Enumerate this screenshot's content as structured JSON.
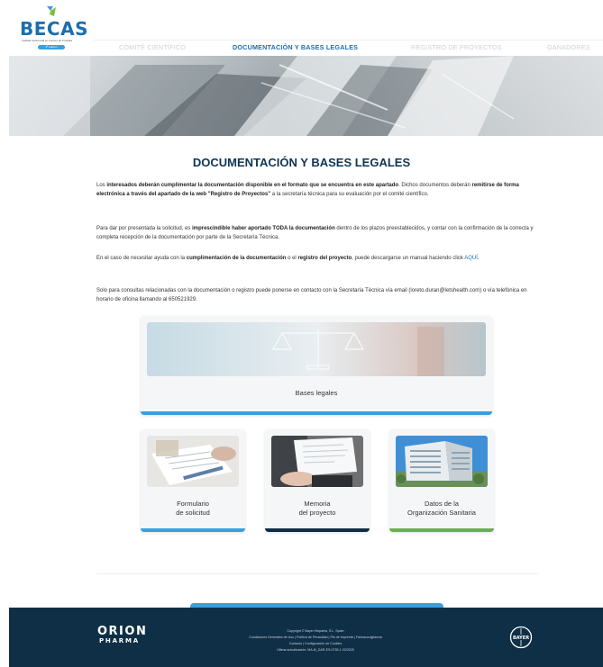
{
  "header": {
    "logo_text": "BECAS",
    "logo_subtitle": "Calidad Asistencial en Cáncer de Próstata",
    "logo_badge": "4ª edición"
  },
  "nav": {
    "items": [
      {
        "label": "COMITÉ CIENTÍFICO",
        "active": false
      },
      {
        "label": "DOCUMENTACIÓN Y BASES LEGALES",
        "active": true
      },
      {
        "label": "REGISTRO DE PROYECTOS",
        "active": false
      },
      {
        "label": "GANADORES",
        "active": false
      }
    ]
  },
  "main": {
    "title": "DOCUMENTACIÓN Y BASES LEGALES",
    "p1": {
      "t1": "Los ",
      "b1": "interesados deberán cumplimentar la documentación disponible en el formato que se encuentra en este apartado",
      "t2": ". Dichos documentos deberán ",
      "b2": "remitirse de forma electrónica a través del apartado de la web \"Registro de Proyectos\"",
      "t3": " a la secretaría técnica para su evaluación por el comité científico."
    },
    "p2": {
      "t1": "Para dar por presentada la solicitud, es ",
      "b1": "imprescindible haber aportado TODA la documentación",
      "t2": " dentro de los plazos preestablecidos, y contar con la confirmación de la correcta y completa recepción de la documentación por parte de la Secretaría Técnica."
    },
    "p3": {
      "t1": "En el caso de necesitar ayuda con la ",
      "b1": "cumplimentación de la documentación",
      "t2": " o el ",
      "b2": "registro del proyecto",
      "t3": ", puede descargarse un manual haciendo click ",
      "link": "AQUÍ",
      "t4": "."
    },
    "p4": "Solo para consultas relacionadas con la documentación o registro puede ponerse en contacto con la Secretaría Técnica vía email (loreto.duran@letshealth.com) o vía telefónica en horario de oficina llamando al 650521929."
  },
  "cards": {
    "bases": {
      "label": "Bases legales",
      "bar_color": "#3aa0dd"
    },
    "formulario": {
      "line1": "Formulario",
      "line2": "de solicitud",
      "bar_color": "#3aa0dd"
    },
    "memoria": {
      "line1": "Memoria",
      "line2": "del proyecto",
      "bar_color": "#0f2f46"
    },
    "datos": {
      "line1": "Datos de la",
      "line2": "Organización Sanitaria",
      "bar_color": "#6ab04c"
    }
  },
  "footer": {
    "orion_line1": "ORION",
    "orion_line2": "PHARMA",
    "line1": "Copyright © Bayer Hispania, S.L. Spain",
    "line2": "Condiciones Generales de Uso | Política de Privacidad | Pie de Imprenta | Farmacovigilancia",
    "line3": "Contacto | Configuración de Cookies",
    "line4": "Última actualización: MA-M_DAR-ES-0735-1 02/2025",
    "bayer": "BAYER"
  },
  "colors": {
    "brand_blue": "#1a6fb0",
    "accent_blue": "#3aa0dd",
    "navy": "#0f2f46",
    "green": "#6ab04c"
  }
}
